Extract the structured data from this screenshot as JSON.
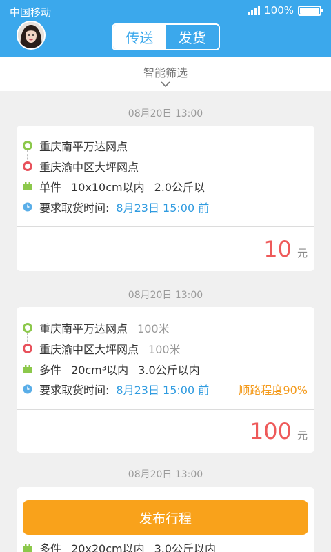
{
  "status_bar": {
    "carrier": "中国移动",
    "battery": "100%",
    "battery_level": 1.0
  },
  "header": {
    "tabs": [
      {
        "label": "传送",
        "active": true
      },
      {
        "label": "发货",
        "active": false
      }
    ]
  },
  "filter": {
    "label": "智能筛选"
  },
  "colors": {
    "brand_blue": "#3ba8ec",
    "price_red": "#ee5a5a",
    "accent_orange": "#f9a21b",
    "origin_green": "#8cc84b",
    "dest_red": "#e8525c"
  },
  "orders": [
    {
      "date": "08月20日 13:00",
      "origin": "重庆南平万达网点",
      "origin_distance": "",
      "destination": "重庆渝中区大坪网点",
      "destination_distance": "",
      "count": "单件",
      "size": "10x10cm以内",
      "weight": "2.0公斤以",
      "pickup_label": "要求取货时间:",
      "pickup_time": "8月23日 15:00 前",
      "route_match": "",
      "price": "10",
      "unit": "元"
    },
    {
      "date": "08月20日 13:00",
      "origin": "重庆南平万达网点",
      "origin_distance": "100米",
      "destination": "重庆渝中区大坪网点",
      "destination_distance": "100米",
      "count": "多件",
      "size": "20cm³以内",
      "weight": "3.0公斤以内",
      "pickup_label": "要求取货时间:",
      "pickup_time": "8月23日 15:00 前",
      "route_match": "顺路程度90%",
      "price": "100",
      "unit": "元"
    },
    {
      "date": "08月20日 13:00",
      "count": "多件",
      "size": "20x20cm以内",
      "weight": "3.0公斤以内"
    }
  ],
  "publish_button": {
    "label": "发布行程"
  }
}
